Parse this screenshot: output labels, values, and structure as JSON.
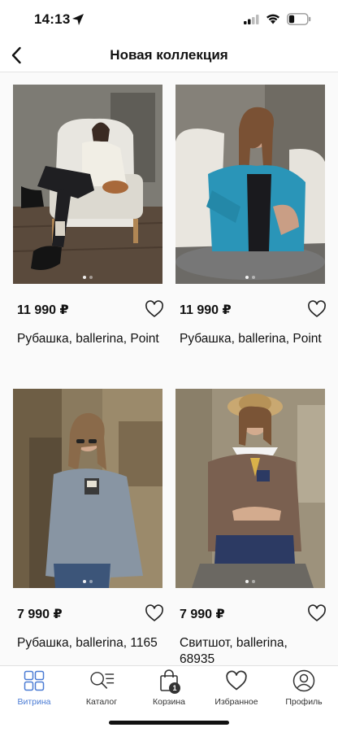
{
  "status_bar": {
    "time": "14:13",
    "battery_level": 0.3
  },
  "nav": {
    "title": "Новая коллекция",
    "back_icon": "chevron-left-icon"
  },
  "products": [
    {
      "price": "11 990 ₽",
      "name": "Рубашка, ballerina, Point",
      "image": "woman-in-cream-jacket-in-armchair"
    },
    {
      "price": "11 990 ₽",
      "name": "Рубашка, ballerina, Point",
      "image": "woman-in-teal-shirt-in-armchair"
    },
    {
      "price": "7 990 ₽",
      "name": "Рубашка, ballerina, 1165",
      "image": "woman-in-grey-shirt-with-sunglasses"
    },
    {
      "price": "7 990 ₽",
      "name": "Свитшот, ballerina, 68935",
      "image": "woman-in-brown-sweatshirt-with-straw-hat"
    }
  ],
  "tabs": [
    {
      "label": "Витрина",
      "icon": "grid-icon",
      "active": true
    },
    {
      "label": "Каталог",
      "icon": "search-list-icon",
      "active": false
    },
    {
      "label": "Корзина",
      "icon": "shopping-bag-icon",
      "active": false,
      "badge": "1"
    },
    {
      "label": "Избранное",
      "icon": "heart-icon",
      "active": false
    },
    {
      "label": "Профиль",
      "icon": "profile-icon",
      "active": false
    }
  ],
  "colors": {
    "accent": "#4a7bd4",
    "text": "#111111",
    "grid_background": "#fafafa"
  }
}
